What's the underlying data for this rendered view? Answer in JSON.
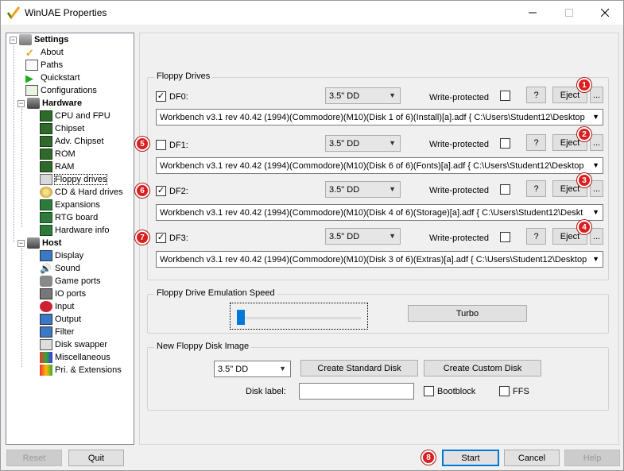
{
  "window": {
    "title": "WinUAE Properties"
  },
  "tree": {
    "groups": [
      {
        "label": "Settings",
        "items": [
          "About",
          "Paths",
          "Quickstart",
          "Configurations"
        ]
      },
      {
        "label": "Hardware",
        "items": [
          "CPU and FPU",
          "Chipset",
          "Adv. Chipset",
          "ROM",
          "RAM",
          "Floppy drives",
          "CD & Hard drives",
          "Expansions",
          "RTG board",
          "Hardware info"
        ]
      },
      {
        "label": "Host",
        "items": [
          "Display",
          "Sound",
          "Game ports",
          "IO ports",
          "Input",
          "Output",
          "Filter",
          "Disk swapper",
          "Miscellaneous",
          "Pri. & Extensions"
        ]
      }
    ],
    "selected": "Floppy drives"
  },
  "floppy": {
    "group_label": "Floppy Drives",
    "write_protected_label": "Write-protected",
    "help_label": "?",
    "eject_label": "Eject",
    "browse_label": "...",
    "drives": [
      {
        "name": "DF0:",
        "type": "3.5\" DD",
        "path": "Workbench v3.1 rev 40.42 (1994)(Commodore)(M10)(Disk 1 of 6)(Install)[a].adf { C:\\Users\\Student12\\Desktop",
        "badge": "1",
        "side_badge": ""
      },
      {
        "name": "DF1:",
        "type": "3.5\" DD",
        "path": "Workbench v3.1 rev 40.42 (1994)(Commodore)(M10)(Disk 6 of 6)(Fonts)[a].adf { C:\\Users\\Student12\\Desktop",
        "badge": "2",
        "side_badge": "5"
      },
      {
        "name": "DF2:",
        "type": "3.5\" DD",
        "path": "Workbench v3.1 rev 40.42 (1994)(Commodore)(M10)(Disk 4 of 6)(Storage)[a].adf { C:\\Users\\Student12\\Deskt",
        "badge": "3",
        "side_badge": "6"
      },
      {
        "name": "DF3:",
        "type": "3.5\" DD",
        "path": "Workbench v3.1 rev 40.42 (1994)(Commodore)(M10)(Disk 3 of 6)(Extras)[a].adf { C:\\Users\\Student12\\Desktop",
        "badge": "4",
        "side_badge": "7"
      }
    ]
  },
  "speed": {
    "group_label": "Floppy Drive Emulation Speed",
    "turbo_label": "Turbo",
    "slider_level": 0
  },
  "new_disk": {
    "group_label": "New Floppy Disk Image",
    "type": "3.5\" DD",
    "create_standard_label": "Create Standard Disk",
    "create_custom_label": "Create Custom Disk",
    "disk_label_label": "Disk label:",
    "disk_label_value": "",
    "bootblock_label": "Bootblock",
    "ffs_label": "FFS"
  },
  "footer": {
    "reset_label": "Reset",
    "quit_label": "Quit",
    "start_label": "Start",
    "start_badge": "8",
    "cancel_label": "Cancel",
    "help_label": "Help"
  },
  "colors": {
    "badge": "#d9201e",
    "accent": "#0078d7"
  }
}
